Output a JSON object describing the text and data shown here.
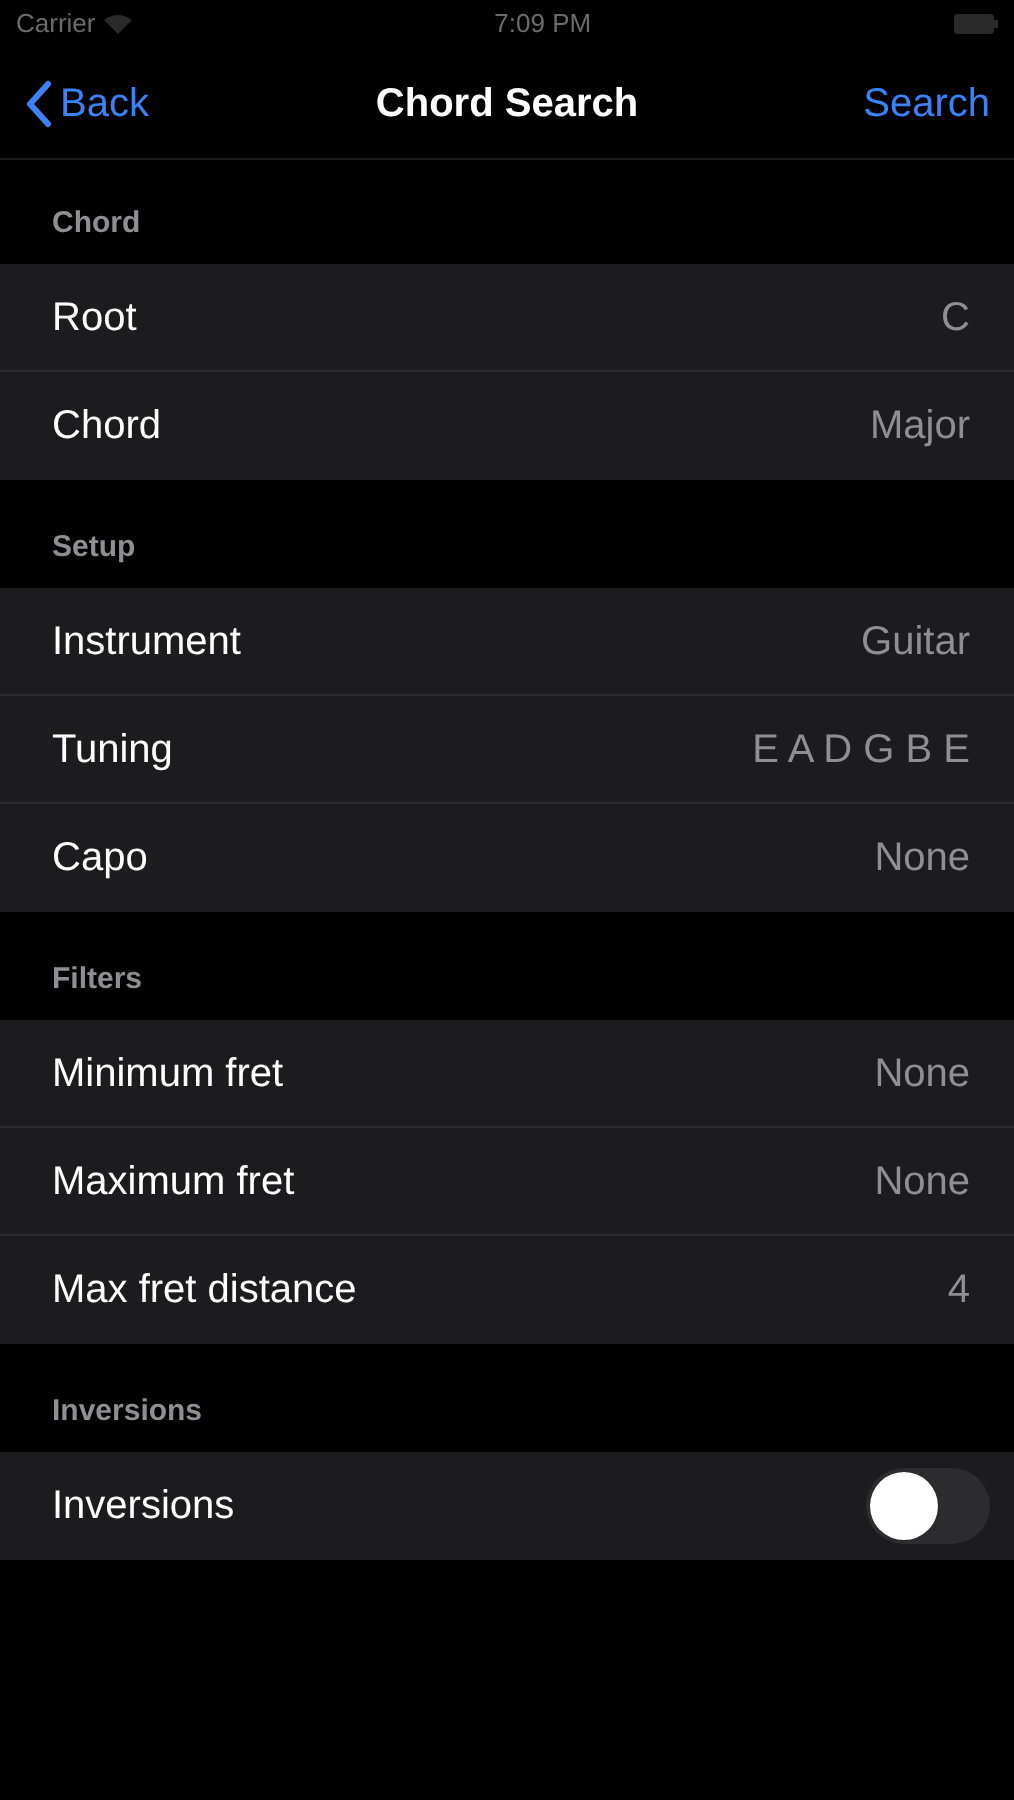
{
  "status_bar": {
    "carrier": "Carrier",
    "time": "7:09 PM"
  },
  "nav": {
    "back": "Back",
    "title": "Chord Search",
    "action": "Search"
  },
  "sections": [
    {
      "header": "Chord",
      "rows": [
        {
          "kind": "value",
          "label": "Root",
          "value": "C"
        },
        {
          "kind": "value",
          "label": "Chord",
          "value": "Major"
        }
      ]
    },
    {
      "header": "Setup",
      "rows": [
        {
          "kind": "value",
          "label": "Instrument",
          "value": "Guitar"
        },
        {
          "kind": "value",
          "label": "Tuning",
          "value": "E A D G B E"
        },
        {
          "kind": "value",
          "label": "Capo",
          "value": "None"
        }
      ]
    },
    {
      "header": "Filters",
      "rows": [
        {
          "kind": "value",
          "label": "Minimum fret",
          "value": "None"
        },
        {
          "kind": "value",
          "label": "Maximum fret",
          "value": "None"
        },
        {
          "kind": "value",
          "label": "Max fret distance",
          "value": "4"
        }
      ]
    },
    {
      "header": "Inversions",
      "rows": [
        {
          "kind": "toggle",
          "label": "Inversions",
          "on": false
        }
      ]
    }
  ]
}
